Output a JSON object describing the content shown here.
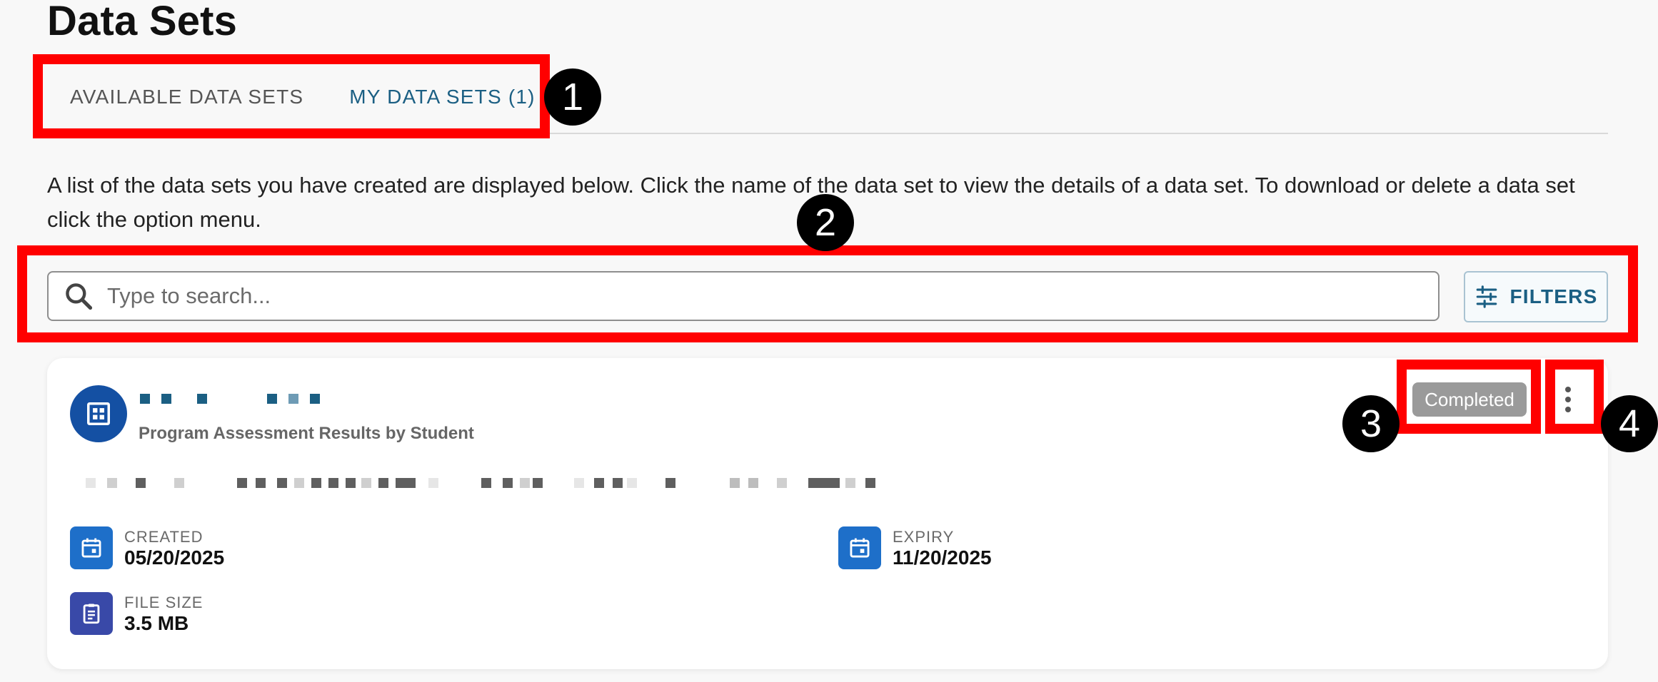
{
  "page": {
    "title": "Data Sets"
  },
  "tabs": [
    {
      "label": "AVAILABLE DATA SETS",
      "active": false
    },
    {
      "label": "MY DATA SETS (1)",
      "active": true
    }
  ],
  "description": "A list of the data sets you have created are displayed below. Click the name of the data set to view the details of a data set. To download or delete a data set click the option menu.",
  "search": {
    "placeholder": "Type to search...",
    "value": "",
    "icon": "search-icon"
  },
  "filters": {
    "label": "FILTERS",
    "icon": "filters-icon"
  },
  "dataset_card": {
    "icon": "table-grid-icon",
    "title_redacted": true,
    "subtitle": "Program Assessment Results by Student",
    "description_redacted": true,
    "status": "Completed",
    "menu_icon": "more-vert-icon",
    "created": {
      "label": "CREATED",
      "value": "05/20/2025",
      "icon": "calendar-icon"
    },
    "expiry": {
      "label": "EXPIRY",
      "value": "11/20/2025",
      "icon": "calendar-icon"
    },
    "file_size": {
      "label": "FILE SIZE",
      "value": "3.5 MB",
      "icon": "clipboard-icon"
    }
  },
  "annotations": [
    "1",
    "2",
    "3",
    "4"
  ],
  "colors": {
    "accent": "#1b5f83",
    "annotation_red": "#ff0000",
    "avatar_blue": "#1450a3",
    "calendar_blue": "#1e6fc9",
    "clipboard_indigo": "#3949a8",
    "badge_gray": "#9a9a9a"
  }
}
